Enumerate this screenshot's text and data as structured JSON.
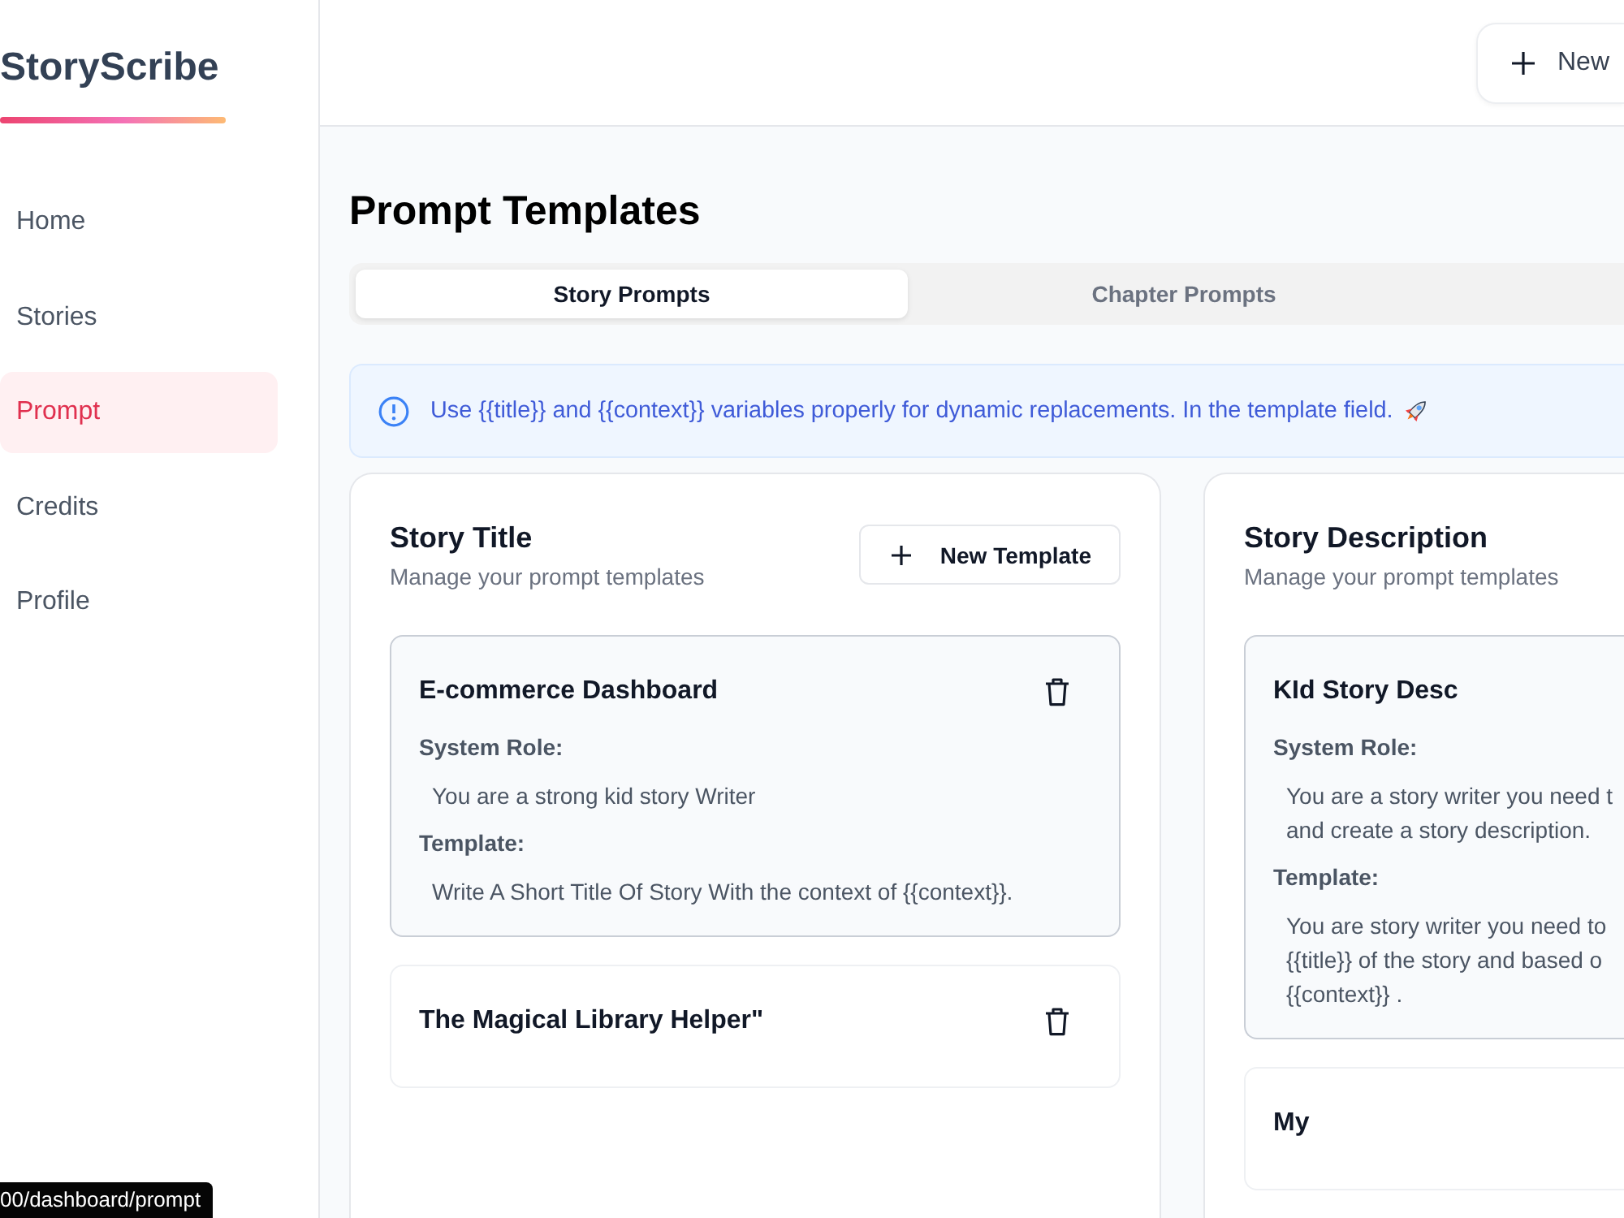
{
  "sidebar": {
    "logo": "StoryScribe",
    "items": [
      {
        "label": "Home",
        "selected": false
      },
      {
        "label": "Stories",
        "selected": false
      },
      {
        "label": "Prompt",
        "selected": true
      },
      {
        "label": "Credits",
        "selected": false
      },
      {
        "label": "Profile",
        "selected": false
      }
    ]
  },
  "header": {
    "new_button": "New"
  },
  "page_title": "Prompt Templates",
  "tabs": [
    {
      "label": "Story Prompts",
      "selected": true
    },
    {
      "label": "Chapter Prompts",
      "selected": false
    }
  ],
  "alert": {
    "text": "Use {{title}} and {{context}} variables properly for dynamic replacements. In the template field."
  },
  "columns": [
    {
      "title": "Story Title",
      "subtitle": "Manage your prompt templates",
      "new_button": "New Template",
      "templates": [
        {
          "name": "E-commerce Dashboard",
          "expanded": true,
          "deletable": true,
          "system_role_label": "System Role:",
          "system_role": [
            "You are a strong kid story Writer"
          ],
          "template_label": "Template:",
          "template": [
            "Write A Short Title Of Story With the context of {{context}}."
          ]
        },
        {
          "name": "The Magical Library Helper\"",
          "expanded": false,
          "deletable": true
        }
      ]
    },
    {
      "title": "Story Description",
      "subtitle": "Manage your prompt templates",
      "templates": [
        {
          "name": "KId Story Desc",
          "expanded": true,
          "system_role_label": "System Role:",
          "system_role": [
            "You are a story writer you need t",
            "and create a story description."
          ],
          "template_label": "Template:",
          "template": [
            "You are story writer you need to",
            "{{title}} of the story and based o",
            "{{context}} ."
          ]
        },
        {
          "name": "My",
          "expanded": false
        }
      ]
    }
  ],
  "status_url": "00/dashboard/prompt"
}
